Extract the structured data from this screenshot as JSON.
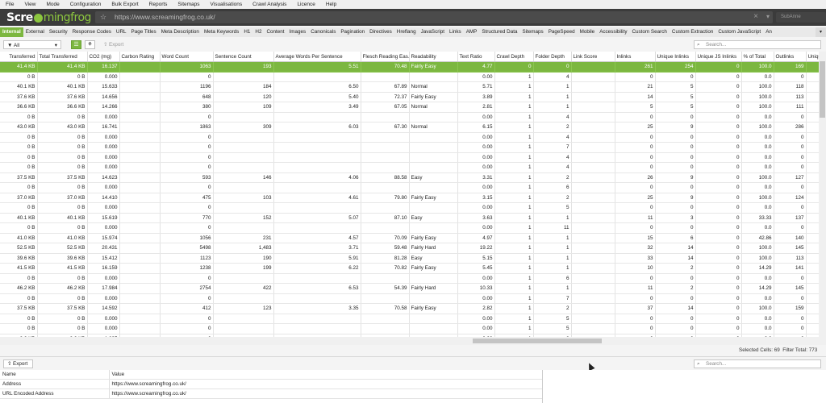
{
  "menu": [
    "File",
    "View",
    "Mode",
    "Configuration",
    "Bulk Export",
    "Reports",
    "Sitemaps",
    "Visualisations",
    "Crawl Analysis",
    "Licence",
    "Help"
  ],
  "brand": {
    "part1": "Scre",
    "part2": "mingfrog"
  },
  "url_bar": {
    "url": "https://www.screamingfrog.co.uk/",
    "right_label": "SubAnne"
  },
  "tabs": [
    "Internal",
    "External",
    "Security",
    "Response Codes",
    "URL",
    "Page Titles",
    "Meta Description",
    "Meta Keywords",
    "H1",
    "H2",
    "Content",
    "Images",
    "Canonicals",
    "Pagination",
    "Directives",
    "Hreflang",
    "JavaScript",
    "Links",
    "AMP",
    "Structured Data",
    "Sitemaps",
    "PageSpeed",
    "Mobile",
    "Accessibility",
    "Custom Search",
    "Custom Extraction",
    "Custom JavaScript",
    "An"
  ],
  "active_tab": "Internal",
  "toolbar": {
    "filter": "All",
    "export": "Export",
    "search_placeholder": "Search..."
  },
  "columns": [
    "Transferred",
    "Total Transferred",
    "CO2 (mg)",
    "Carbon Rating",
    "Word Count",
    "Sentence Count",
    "Average Words Per Sentence",
    "Flesch Reading Eas...",
    "Readability",
    "Text Ratio",
    "Crawl Depth",
    "Folder Depth",
    "Link Score",
    "Inlinks",
    "Unique Inlinks",
    "Unique JS Inlinks",
    "% of Total",
    "Outlinks",
    "Uniqu"
  ],
  "rows": [
    [
      "41.4 KB",
      "41.4 KB",
      "16.137",
      "",
      "1063",
      "193",
      "5.51",
      "70.48",
      "Fairly Easy",
      "4.77",
      "0",
      "0",
      "",
      "261",
      "254",
      "0",
      "100.0",
      "169",
      ""
    ],
    [
      "0 B",
      "0 B",
      "0.000",
      "",
      "0",
      "",
      "",
      "",
      "",
      "0.00",
      "1",
      "4",
      "",
      "0",
      "0",
      "0",
      "0.0",
      "0",
      ""
    ],
    [
      "40.1 KB",
      "40.1 KB",
      "15.633",
      "",
      "1196",
      "184",
      "6.50",
      "67.89",
      "Normal",
      "5.71",
      "1",
      "1",
      "",
      "21",
      "5",
      "0",
      "100.0",
      "118",
      ""
    ],
    [
      "37.6 KB",
      "37.6 KB",
      "14.656",
      "",
      "648",
      "120",
      "5.40",
      "72.37",
      "Fairly Easy",
      "3.89",
      "1",
      "1",
      "",
      "14",
      "5",
      "0",
      "100.0",
      "113",
      ""
    ],
    [
      "36.6 KB",
      "36.6 KB",
      "14.266",
      "",
      "380",
      "109",
      "3.49",
      "67.05",
      "Normal",
      "2.81",
      "1",
      "1",
      "",
      "5",
      "5",
      "0",
      "100.0",
      "111",
      ""
    ],
    [
      "0 B",
      "0 B",
      "0.000",
      "",
      "0",
      "",
      "",
      "",
      "",
      "0.00",
      "1",
      "4",
      "",
      "0",
      "0",
      "0",
      "0.0",
      "0",
      ""
    ],
    [
      "43.0 KB",
      "43.0 KB",
      "16.741",
      "",
      "1863",
      "309",
      "6.03",
      "67.30",
      "Normal",
      "6.15",
      "1",
      "2",
      "",
      "25",
      "9",
      "0",
      "100.0",
      "286",
      ""
    ],
    [
      "0 B",
      "0 B",
      "0.000",
      "",
      "0",
      "",
      "",
      "",
      "",
      "0.00",
      "1",
      "4",
      "",
      "0",
      "0",
      "0",
      "0.0",
      "0",
      ""
    ],
    [
      "0 B",
      "0 B",
      "0.000",
      "",
      "0",
      "",
      "",
      "",
      "",
      "0.00",
      "1",
      "7",
      "",
      "0",
      "0",
      "0",
      "0.0",
      "0",
      ""
    ],
    [
      "0 B",
      "0 B",
      "0.000",
      "",
      "0",
      "",
      "",
      "",
      "",
      "0.00",
      "1",
      "4",
      "",
      "0",
      "0",
      "0",
      "0.0",
      "0",
      ""
    ],
    [
      "0 B",
      "0 B",
      "0.000",
      "",
      "0",
      "",
      "",
      "",
      "",
      "0.00",
      "1",
      "4",
      "",
      "0",
      "0",
      "0",
      "0.0",
      "0",
      ""
    ],
    [
      "37.5 KB",
      "37.5 KB",
      "14.623",
      "",
      "593",
      "146",
      "4.06",
      "88.58",
      "Easy",
      "3.31",
      "1",
      "2",
      "",
      "26",
      "9",
      "0",
      "100.0",
      "127",
      ""
    ],
    [
      "0 B",
      "0 B",
      "0.000",
      "",
      "0",
      "",
      "",
      "",
      "",
      "0.00",
      "1",
      "6",
      "",
      "0",
      "0",
      "0",
      "0.0",
      "0",
      ""
    ],
    [
      "37.0 KB",
      "37.0 KB",
      "14.410",
      "",
      "475",
      "103",
      "4.61",
      "79.80",
      "Fairly Easy",
      "3.15",
      "1",
      "2",
      "",
      "25",
      "9",
      "0",
      "100.0",
      "124",
      ""
    ],
    [
      "0 B",
      "0 B",
      "0.000",
      "",
      "0",
      "",
      "",
      "",
      "",
      "0.00",
      "1",
      "5",
      "",
      "0",
      "0",
      "0",
      "0.0",
      "0",
      ""
    ],
    [
      "40.1 KB",
      "40.1 KB",
      "15.619",
      "",
      "770",
      "152",
      "5.07",
      "87.10",
      "Easy",
      "3.63",
      "1",
      "1",
      "",
      "11",
      "3",
      "0",
      "33.33",
      "137",
      ""
    ],
    [
      "0 B",
      "0 B",
      "0.000",
      "",
      "0",
      "",
      "",
      "",
      "",
      "0.00",
      "1",
      "11",
      "",
      "0",
      "0",
      "0",
      "0.0",
      "0",
      ""
    ],
    [
      "41.0 KB",
      "41.0 KB",
      "15.974",
      "",
      "1056",
      "231",
      "4.57",
      "70.09",
      "Fairly Easy",
      "4.97",
      "1",
      "1",
      "",
      "15",
      "6",
      "0",
      "42.86",
      "140",
      ""
    ],
    [
      "52.5 KB",
      "52.5 KB",
      "20.431",
      "",
      "5498",
      "1,483",
      "3.71",
      "59.48",
      "Fairly Hard",
      "19.22",
      "1",
      "1",
      "",
      "32",
      "14",
      "0",
      "100.0",
      "145",
      ""
    ],
    [
      "39.6 KB",
      "39.6 KB",
      "15.412",
      "",
      "1123",
      "190",
      "5.91",
      "81.28",
      "Easy",
      "5.15",
      "1",
      "1",
      "",
      "33",
      "14",
      "0",
      "100.0",
      "113",
      ""
    ],
    [
      "41.5 KB",
      "41.5 KB",
      "16.159",
      "",
      "1238",
      "199",
      "6.22",
      "70.82",
      "Fairly Easy",
      "5.45",
      "1",
      "1",
      "",
      "10",
      "2",
      "0",
      "14.29",
      "141",
      ""
    ],
    [
      "0 B",
      "0 B",
      "0.000",
      "",
      "0",
      "",
      "",
      "",
      "",
      "0.00",
      "1",
      "6",
      "",
      "0",
      "0",
      "0",
      "0.0",
      "0",
      ""
    ],
    [
      "46.2 KB",
      "46.2 KB",
      "17.984",
      "",
      "2754",
      "422",
      "6.53",
      "54.39",
      "Fairly Hard",
      "10.33",
      "1",
      "1",
      "",
      "11",
      "2",
      "0",
      "14.29",
      "145",
      ""
    ],
    [
      "0 B",
      "0 B",
      "0.000",
      "",
      "0",
      "",
      "",
      "",
      "",
      "0.00",
      "1",
      "7",
      "",
      "0",
      "0",
      "0",
      "0.0",
      "0",
      ""
    ],
    [
      "37.5 KB",
      "37.5 KB",
      "14.592",
      "",
      "412",
      "123",
      "3.35",
      "70.58",
      "Fairly Easy",
      "2.82",
      "1",
      "2",
      "",
      "37",
      "14",
      "0",
      "100.0",
      "159",
      ""
    ],
    [
      "0 B",
      "0 B",
      "0.000",
      "",
      "0",
      "",
      "",
      "",
      "",
      "0.00",
      "1",
      "5",
      "",
      "0",
      "0",
      "0",
      "0.0",
      "0",
      ""
    ],
    [
      "0 B",
      "0 B",
      "0.000",
      "",
      "0",
      "",
      "",
      "",
      "",
      "0.00",
      "1",
      "5",
      "",
      "0",
      "0",
      "0",
      "0.0",
      "0",
      ""
    ],
    [
      "3.3 KB",
      "3.3 KB",
      "1.295",
      "",
      "0",
      "",
      "",
      "",
      "",
      "0.00",
      "1",
      "8",
      "",
      "0",
      "0",
      "0",
      "0.0",
      "0",
      ""
    ],
    [
      "0 B",
      "0 B",
      "0.000",
      "",
      "0",
      "",
      "",
      "",
      "",
      "0.00",
      "1",
      "5",
      "",
      "0",
      "0",
      "0",
      "0.0",
      "0",
      ""
    ],
    [
      "0 B",
      "0 B",
      "0.000",
      "",
      "0",
      "",
      "",
      "",
      "",
      "0.00",
      "1",
      "6",
      "",
      "0",
      "0",
      "0",
      "0.0",
      "0",
      ""
    ],
    [
      "0 B",
      "0 B",
      "0.000",
      "",
      "0",
      "",
      "",
      "",
      "",
      "0.00",
      "1",
      "5",
      "",
      "0",
      "0",
      "0",
      "0.0",
      "0",
      ""
    ],
    [
      "0 B",
      "0 B",
      "0.000",
      "",
      "0",
      "",
      "",
      "",
      "",
      "0.00",
      "1",
      "3",
      "",
      "0",
      "0",
      "0",
      "0.0",
      "0",
      ""
    ]
  ],
  "status": {
    "selected_label": "Selected Cells:",
    "selected": "69",
    "filter_label": "Filter Total:",
    "filter_total": "773"
  },
  "detail": {
    "export": "Export",
    "search_placeholder": "Search...",
    "headers": [
      "Name",
      "Value"
    ],
    "rows": [
      [
        "Address",
        "https://www.screamingfrog.co.uk/"
      ],
      [
        "URL Encoded Address",
        "https://www.screamingfrog.co.uk/"
      ]
    ]
  },
  "colors": {
    "accent": "#7cb740",
    "header_bg": "#3b3b3b"
  }
}
